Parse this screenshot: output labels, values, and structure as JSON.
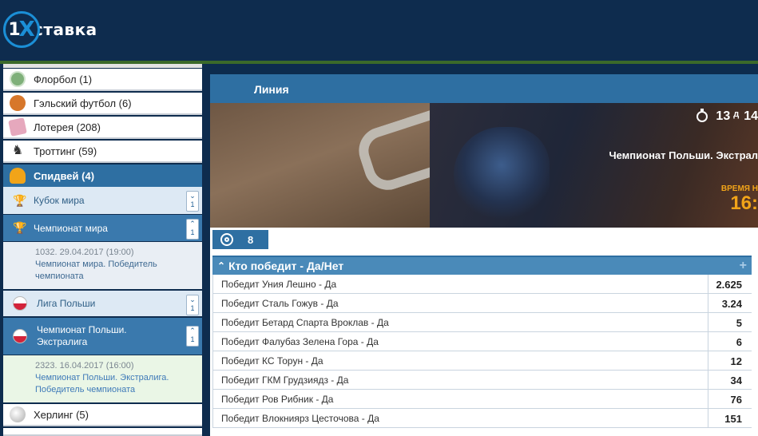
{
  "header": {
    "logo_number": "1",
    "logo_x": "X",
    "logo_text": "ставка"
  },
  "sidebar": {
    "sports": [
      {
        "label": "Флорбол (1)",
        "icon": "floorball-icon",
        "color": "#7fb07a"
      },
      {
        "label": "Гэльский футбол (6)",
        "icon": "gaelic-football-icon",
        "color": "#d7772b"
      },
      {
        "label": "Лотерея (208)",
        "icon": "lottery-icon",
        "color": "#d46b8a"
      },
      {
        "label": "Троттинг (59)",
        "icon": "trotting-horse-icon",
        "color": "#333333"
      }
    ],
    "active_sport": {
      "label": "Спидвей (4)",
      "icon": "speedway-helmet-icon",
      "color": "#f1a419"
    },
    "subs": [
      {
        "label": "Кубок мира",
        "toggle_count": "1"
      },
      {
        "label": "Чемпионат мира",
        "toggle_count": "1"
      },
      {
        "label": "Лига Польши",
        "toggle_count": "1"
      },
      {
        "label": "Чемпионат Польши. Экстралига",
        "toggle_count": "1"
      }
    ],
    "details": [
      {
        "meta": "1032. 29.04.2017 (19:00)",
        "text": "Чемпионат мира. Победитель чемпионата"
      },
      {
        "meta": "2323. 16.04.2017 (16:00)",
        "text": "Чемпионат Польши. Экстралига. Победитель чемпионата"
      }
    ],
    "bottom_sport": {
      "label": "Херлинг (5)",
      "icon": "hurling-icon"
    }
  },
  "main": {
    "liniya_label": "Линия",
    "banner": {
      "days": "13",
      "days_label": "д",
      "hours": "14",
      "championship": "Чемпионат Польши. Экстрал",
      "time_label": "ВРЕМЯ Н",
      "time_value": "16:"
    },
    "tab_count": "8",
    "market": {
      "title": "Кто победит - Да/Нет",
      "rows": [
        {
          "name": "Победит Уния Лешно - Да",
          "odd": "2.625"
        },
        {
          "name": "Победит Сталь Гожув - Да",
          "odd": "3.24"
        },
        {
          "name": "Победит Бетард Спарта Вроклав - Да",
          "odd": "5"
        },
        {
          "name": "Победит Фалубаз Зелена Гора - Да",
          "odd": "6"
        },
        {
          "name": "Победит КС Торун - Да",
          "odd": "12"
        },
        {
          "name": "Победит ГКМ Грудзиядз - Да",
          "odd": "34"
        },
        {
          "name": "Победит Ров Рибник - Да",
          "odd": "76"
        },
        {
          "name": "Победит Влокниярз Цесточова - Да",
          "odd": "151"
        }
      ]
    }
  },
  "colors": {
    "header_bg": "#0e2c4e",
    "accent_blue": "#2e6fa2",
    "timer_orange": "#f1a419"
  }
}
